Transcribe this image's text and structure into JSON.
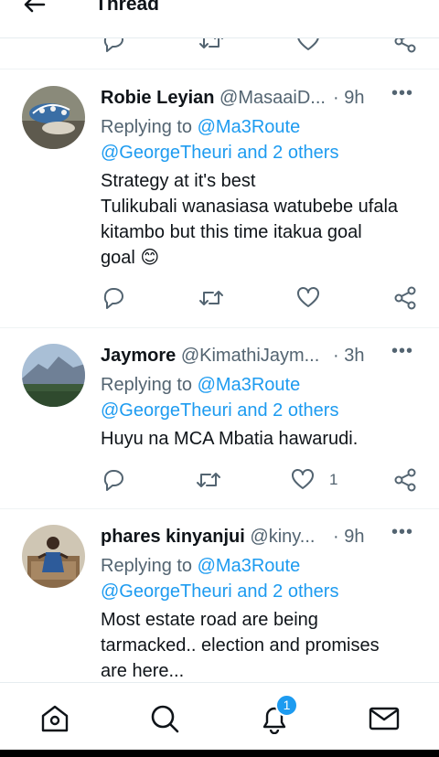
{
  "header": {
    "title": "Thread"
  },
  "tweets": [
    {
      "name": "Robie Leyian",
      "handle": "@MasaaiD...",
      "time": "· 9h",
      "replying_prefix": "Replying to",
      "replying_user": "@Ma3Route",
      "replying_line2": "@GeorgeTheuri and 2 others",
      "text_lines": [
        "Strategy at it's best",
        "Tulikubali wanasiasa watubebe ufala",
        "kitambo but this time itakua goal",
        "goal 😊"
      ],
      "like_count": ""
    },
    {
      "name": "Jaymore",
      "handle": "@KimathiJaym...",
      "time": "· 3h",
      "replying_prefix": "Replying to",
      "replying_user": "@Ma3Route",
      "replying_line2": "@GeorgeTheuri and 2 others",
      "text_lines": [
        "Huyu na MCA Mbatia hawarudi."
      ],
      "like_count": "1"
    },
    {
      "name": "phares kinyanjui",
      "handle": "@kiny...",
      "time": "· 9h",
      "replying_prefix": "Replying to",
      "replying_user": "@Ma3Route",
      "replying_line2": "@GeorgeTheuri and 2 others",
      "text_lines": [
        "Most estate road are being",
        "tarmacked.. election and promises",
        "are here..."
      ],
      "like_count": ""
    }
  ],
  "bottom_nav": {
    "notification_badge": "1"
  },
  "colors": {
    "accent": "#1d9bf0",
    "text": "#0f1419",
    "secondary": "#536471"
  },
  "icons": [
    "back-arrow-icon",
    "reply-icon",
    "retweet-icon",
    "like-icon",
    "share-icon",
    "more-icon",
    "home-icon",
    "search-icon",
    "notifications-icon",
    "messages-icon"
  ]
}
